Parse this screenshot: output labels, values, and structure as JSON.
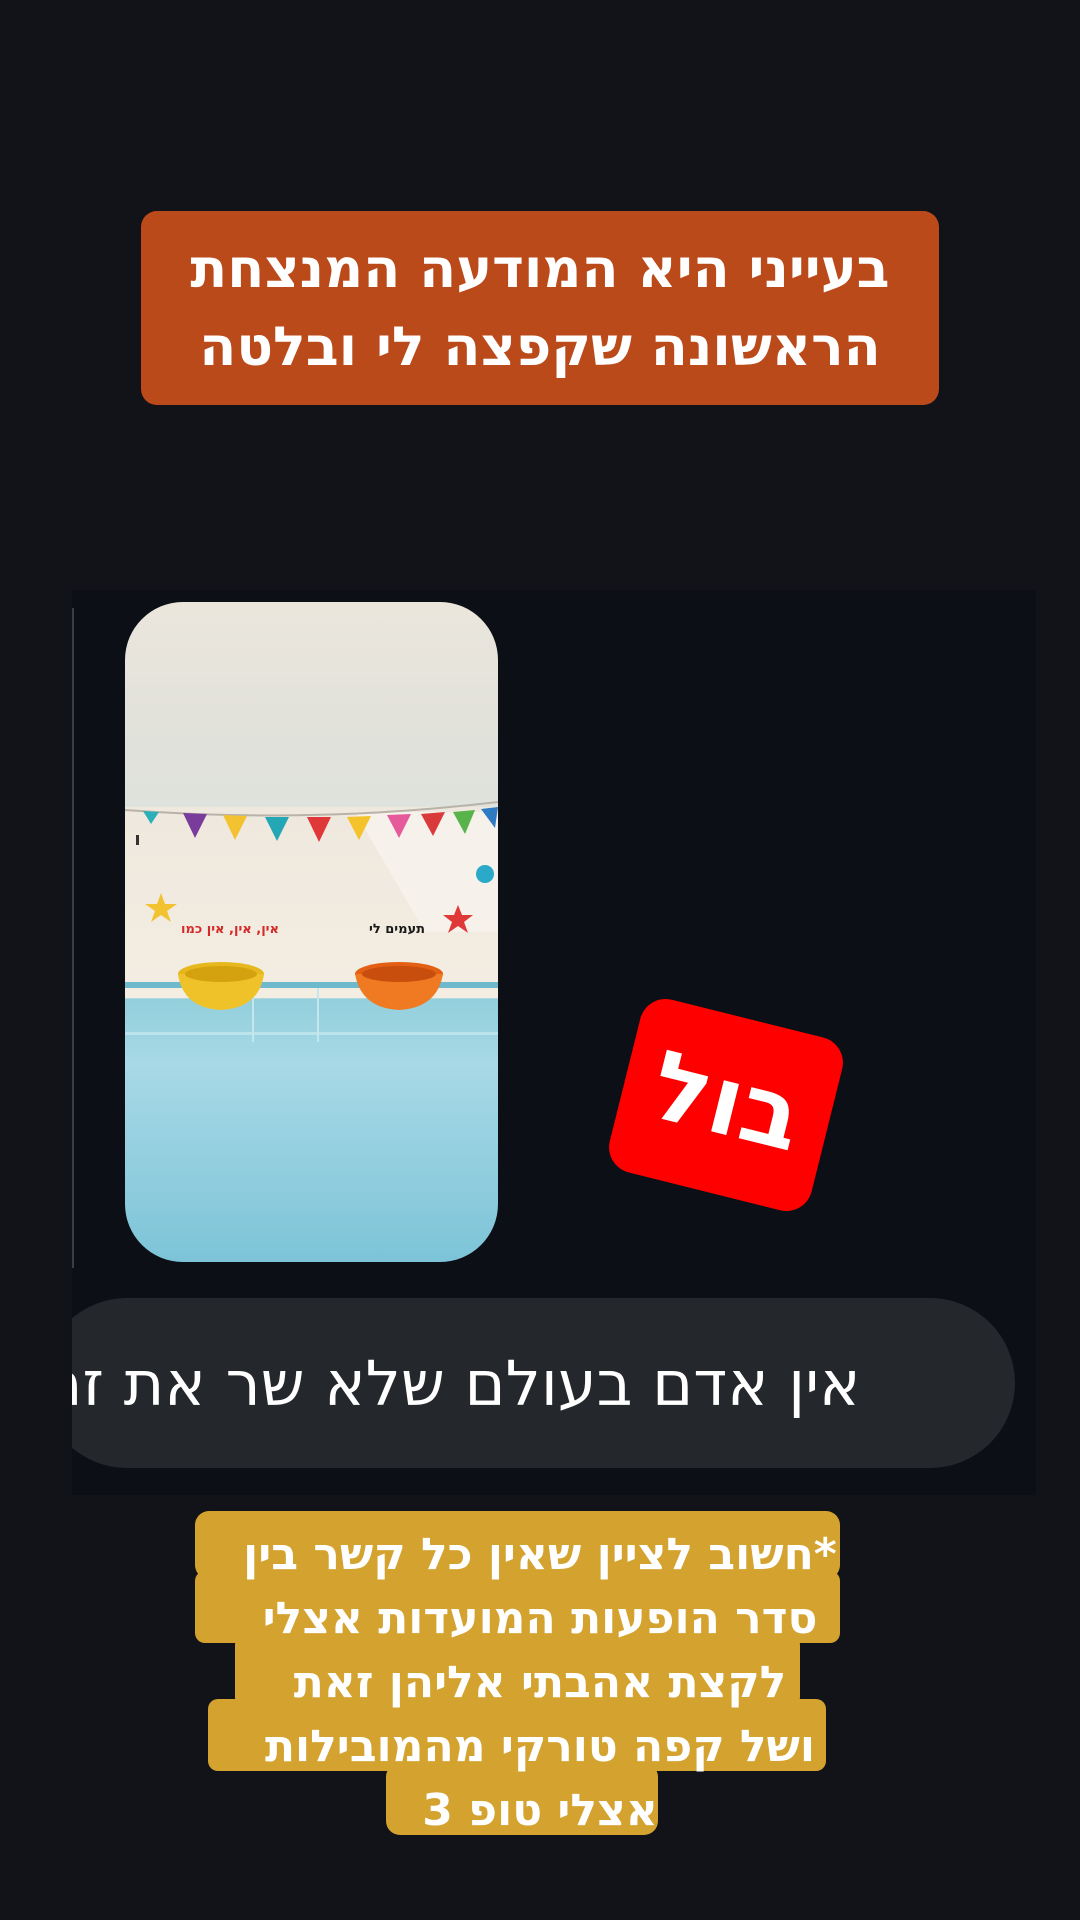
{
  "title_caption": {
    "lines": [
      "בעייני היא המודעה המנצחת",
      "הראשונה שקפצה לי ובלטה"
    ],
    "background_color": "#bb4a1b"
  },
  "ad_thumbnail": {
    "label_left": "אין, אין, אין כמו",
    "label_right": "תעמים לי"
  },
  "sticker": {
    "text": "בול",
    "background_color": "#ff0000"
  },
  "message": {
    "text": "אין אדם בעולם שלא שר את זה",
    "bubble_color": "#24272c"
  },
  "footnote": {
    "lines": [
      "*חשוב לציין שאין כל קשר בין",
      "סדר הופעות המועדות אצלי",
      "לקצת אהבתי אליהן זאת",
      "ושל קפה טורקי מהמובילות",
      "אצלי טופ 3"
    ],
    "background_color": "#d4a22f"
  }
}
